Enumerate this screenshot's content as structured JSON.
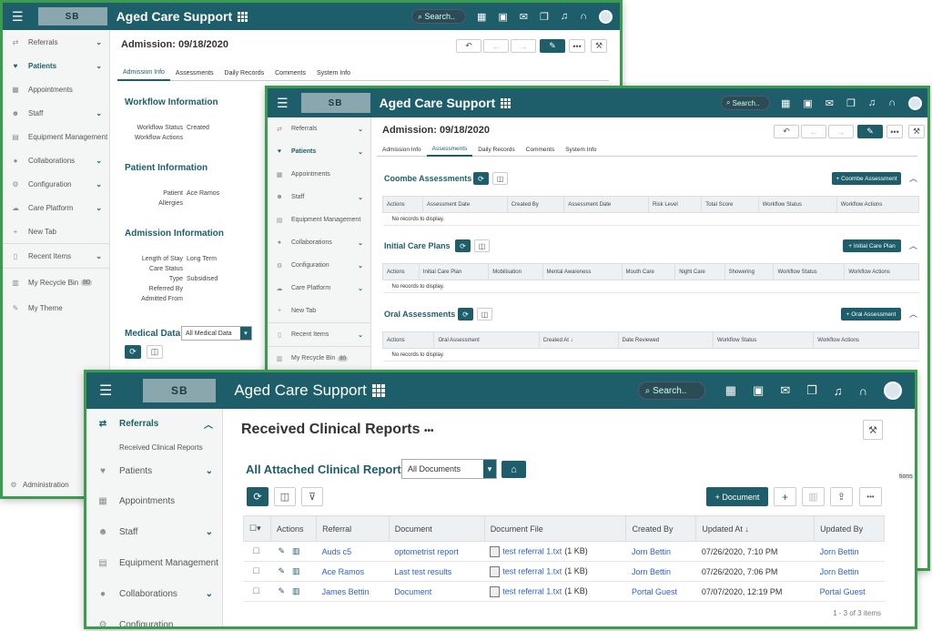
{
  "app": {
    "title": "Aged Care Support",
    "search_placeholder": "Search..",
    "logo_text": "SB"
  },
  "sidebar": {
    "items": [
      "Referrals",
      "Patients",
      "Appointments",
      "Staff",
      "Equipment Management",
      "Collaborations",
      "Configuration",
      "Care Platform",
      "New Tab",
      "Recent Items",
      "My Recycle Bin",
      "My Theme"
    ],
    "sub_referrals": "Received Clinical Reports",
    "recycle_badge": "80",
    "admin": "Administration"
  },
  "admission": {
    "title": "Admission: 09/18/2020",
    "tabs": [
      "Admission Info",
      "Assessments",
      "Daily Records",
      "Comments",
      "System Info"
    ],
    "workflow": {
      "heading": "Workflow Information",
      "status_label": "Workflow Status",
      "status_value": "Created",
      "actions_label": "Workflow Actions"
    },
    "patient": {
      "heading": "Patient Information",
      "patient_label": "Patient",
      "patient_value": "Ace Ramos",
      "allergies_label": "Allergies"
    },
    "admission_info": {
      "heading": "Admission Information",
      "stay_label": "Length of Stay",
      "stay_value": "Long Term",
      "care_label": "Care Status",
      "type_label": "Type",
      "type_value": "Subsidised",
      "ref_label": "Referred By",
      "from_label": "Admitted From"
    },
    "medical": {
      "heading": "Medical Data",
      "select_value": "All Medical Data"
    }
  },
  "assessments": {
    "coombe": {
      "heading": "Coombe Assessments",
      "button": "+ Coombe Assessment",
      "columns": [
        "Actions",
        "Assessment Date",
        "Created By",
        "Assessment Date",
        "Risk Level",
        "Total Score",
        "Workflow Status",
        "Workflow Actions"
      ]
    },
    "initial": {
      "heading": "Initial Care Plans",
      "button": "+ Initial Care Plan",
      "columns": [
        "Actions",
        "Initial Care Plan",
        "Mobilisation",
        "Mental Awareness",
        "Mouth Care",
        "Night Care",
        "Showering",
        "Workflow Status",
        "Workflow Actions"
      ]
    },
    "oral": {
      "heading": "Oral Assessments",
      "button": "+ Oral Assessment",
      "columns": [
        "Actions",
        "Oral Assessment",
        "Created At ↓",
        "Date Reviewed",
        "Workflow Status",
        "Workflow Actions"
      ]
    },
    "empty": "No records to display."
  },
  "reports": {
    "title": "Received Clinical Reports",
    "subtitle": "All Attached Clinical Reports",
    "select_value": "All Documents",
    "doc_button": "+ Document",
    "columns": [
      "Actions",
      "Referral",
      "Document",
      "Document File",
      "Created By",
      "Updated At ↓",
      "Updated By"
    ],
    "rows": [
      {
        "referral": "Auds c5",
        "document": "optometrist report",
        "file": "test referral 1.txt",
        "size": "(1 KB)",
        "created_by": "Jorn Bettin",
        "updated_at": "07/26/2020, 7:10 PM",
        "updated_by": "Jorn Bettin"
      },
      {
        "referral": "Ace Ramos",
        "document": "Last test results",
        "file": "test referral 1.txt",
        "size": "(1 KB)",
        "created_by": "Jorn Bettin",
        "updated_at": "07/26/2020, 7:06 PM",
        "updated_by": "Jorn Bettin"
      },
      {
        "referral": "James Bettin",
        "document": "Document",
        "file": "test referral 1.txt",
        "size": "(1 KB)",
        "created_by": "Portal Guest",
        "updated_at": "07/07/2020, 12:19 PM",
        "updated_by": "Portal Guest"
      }
    ],
    "pager": "1 - 3 of 3 items",
    "side_fragment": "tions"
  },
  "colors": {
    "brand": "#1d5e6a",
    "frame": "#3b9b4f",
    "link": "#2c62c7"
  }
}
